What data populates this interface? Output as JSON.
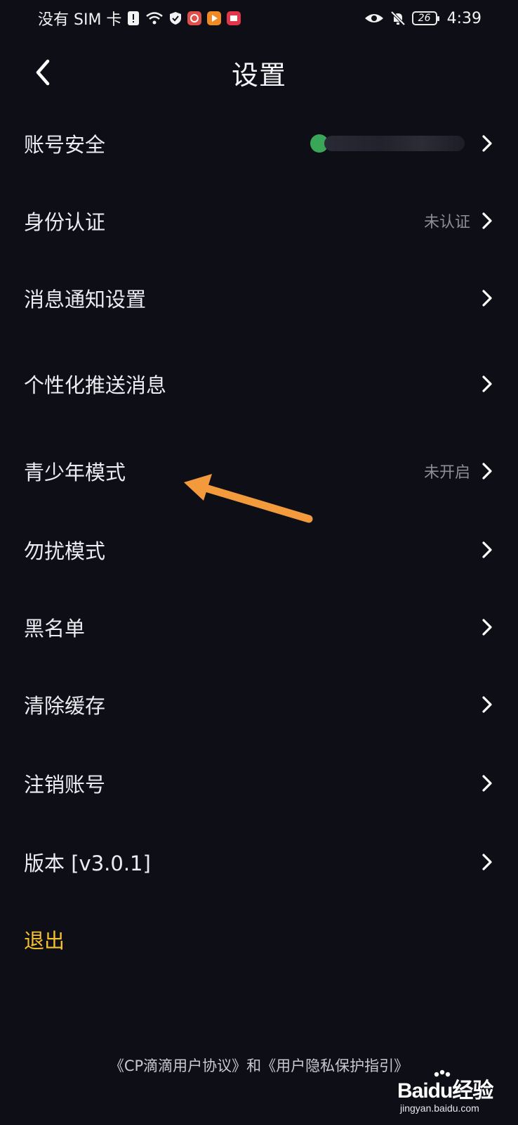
{
  "status_bar": {
    "carrier": "没有 SIM 卡",
    "battery": "26",
    "time": "4:39",
    "icons": [
      "alert-icon",
      "wifi-icon",
      "shield-icon",
      "app-icon-1",
      "app-icon-2",
      "app-icon-3",
      "eye-icon",
      "bell-off-icon",
      "battery-icon"
    ]
  },
  "header": {
    "title": "设置"
  },
  "settings": {
    "account_security": {
      "label": "账号安全"
    },
    "identity": {
      "label": "身份认证",
      "value": "未认证"
    },
    "notifications": {
      "label": "消息通知设置"
    },
    "personalized_push": {
      "label": "个性化推送消息"
    },
    "teen_mode": {
      "label": "青少年模式",
      "value": "未开启"
    },
    "dnd_mode": {
      "label": "勿扰模式"
    },
    "blacklist": {
      "label": "黑名单"
    },
    "clear_cache": {
      "label": "清除缓存"
    },
    "delete_account": {
      "label": "注销账号"
    },
    "version": {
      "label": "版本 [v3.0.1]"
    },
    "logout": {
      "label": "退出"
    }
  },
  "footer": {
    "text": "《CP滴滴用户协议》和《用户隐私保护指引》"
  },
  "watermark": {
    "brand": "Baidu经验",
    "url": "jingyan.baidu.com"
  },
  "colors": {
    "background": "#0e0e17",
    "text": "#ececf0",
    "secondary": "#8d8d96",
    "accent": "#f5c02c",
    "annotation": "#f39a3c"
  }
}
